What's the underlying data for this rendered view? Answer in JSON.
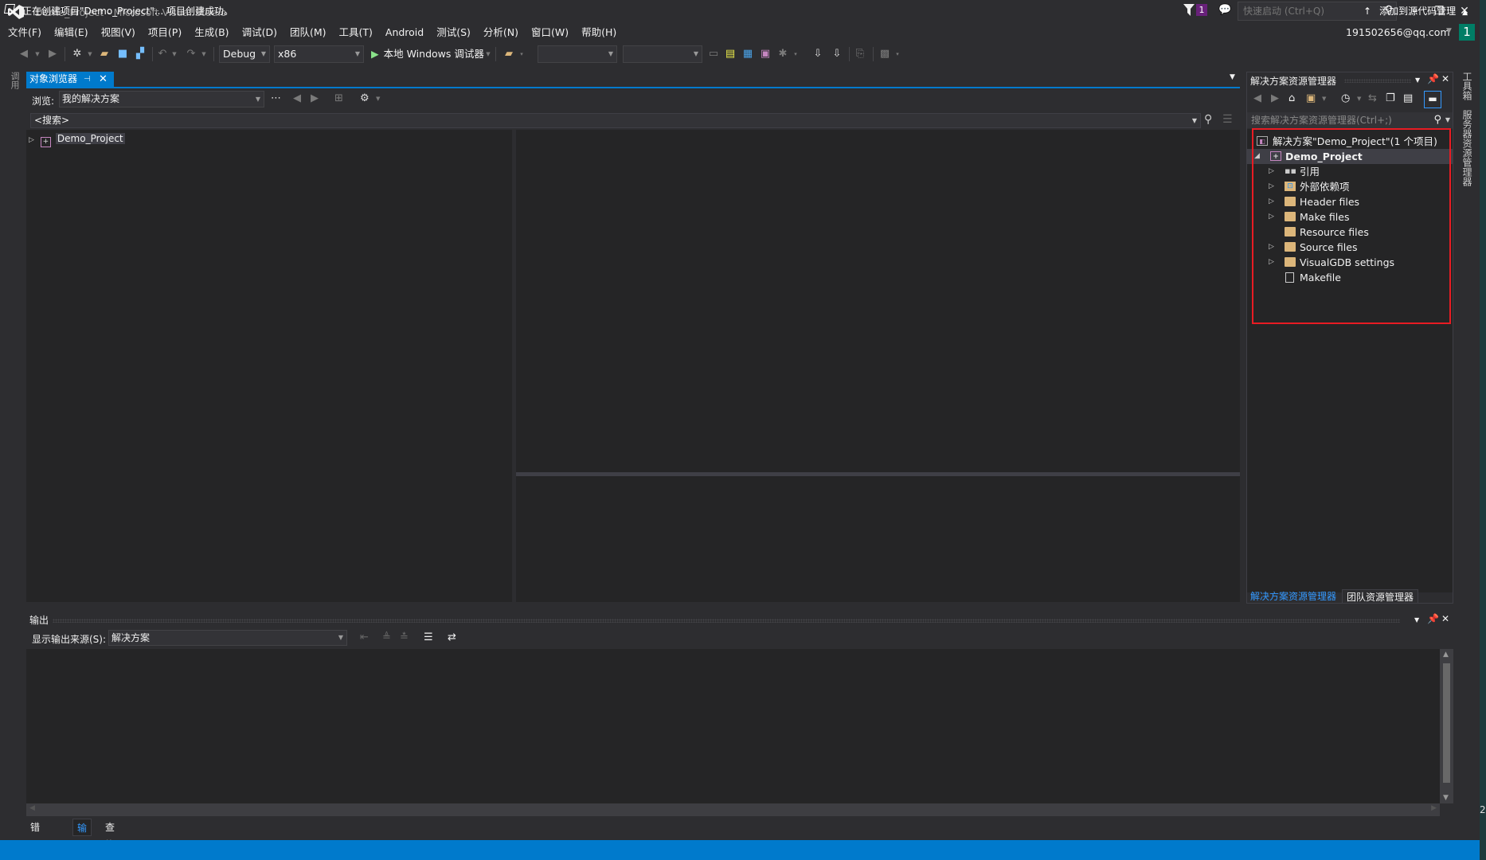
{
  "window": {
    "title": "Demo_Project - Microsoft Visual Studio",
    "notification_count": "1",
    "quick_launch_placeholder": "快速启动 (Ctrl+Q)",
    "account": "191502656@qq.com",
    "account_badge": "1"
  },
  "menu": [
    {
      "label": "文件(F)"
    },
    {
      "label": "编辑(E)"
    },
    {
      "label": "视图(V)"
    },
    {
      "label": "项目(P)"
    },
    {
      "label": "生成(B)"
    },
    {
      "label": "调试(D)"
    },
    {
      "label": "团队(M)"
    },
    {
      "label": "工具(T)"
    },
    {
      "label": "Android"
    },
    {
      "label": "测试(S)"
    },
    {
      "label": "分析(N)"
    },
    {
      "label": "窗口(W)"
    },
    {
      "label": "帮助(H)"
    }
  ],
  "toolbar": {
    "configuration": "Debug",
    "platform": "x86",
    "run_label": "本地 Windows 调试器"
  },
  "left_strip": {
    "tab_label": "调用"
  },
  "document": {
    "tab_label": "对象浏览器",
    "browse_label": "浏览:",
    "browse_value": "我的解决方案",
    "search_value": "<搜索>",
    "tree": [
      {
        "label": "Demo_Project",
        "expanded": false
      }
    ]
  },
  "solution_explorer": {
    "title": "解决方案资源管理器",
    "search_placeholder": "搜索解决方案资源管理器(Ctrl+;)",
    "solution_label": "解决方案\"Demo_Project\"(1 个项目)",
    "project_label": "Demo_Project",
    "items": [
      {
        "label": "引用",
        "icon": "references-icon",
        "expandable": true
      },
      {
        "label": "外部依赖项",
        "icon": "external-deps-icon",
        "expandable": true
      },
      {
        "label": "Header files",
        "icon": "folder-icon",
        "expandable": true
      },
      {
        "label": "Make files",
        "icon": "folder-icon",
        "expandable": true
      },
      {
        "label": "Resource files",
        "icon": "folder-icon",
        "expandable": false
      },
      {
        "label": "Source files",
        "icon": "folder-icon",
        "expandable": true
      },
      {
        "label": "VisualGDB settings",
        "icon": "folder-icon",
        "expandable": true
      },
      {
        "label": "Makefile",
        "icon": "file-icon",
        "expandable": false
      }
    ],
    "bottom_tabs": [
      {
        "label": "解决方案资源管理器",
        "active": true
      },
      {
        "label": "团队资源管理器",
        "active": false
      }
    ],
    "highlight_color": "#e81c23"
  },
  "right_strip": {
    "tabs": [
      "工具箱",
      "服务器资源管理器"
    ]
  },
  "output": {
    "title": "输出",
    "source_label": "显示输出来源(S):",
    "source_value": "解决方案",
    "content": ""
  },
  "bottom_tabs": [
    {
      "label": "错误列表",
      "active": false
    },
    {
      "label": "输出",
      "active": true
    },
    {
      "label": "查找符号结果",
      "active": false
    }
  ],
  "status": {
    "message": "正在创建项目\"Demo_Project\"... 项目创建成功。",
    "source_control": "添加到源代码管理",
    "accent": "#007acc"
  },
  "edge_label": "2"
}
